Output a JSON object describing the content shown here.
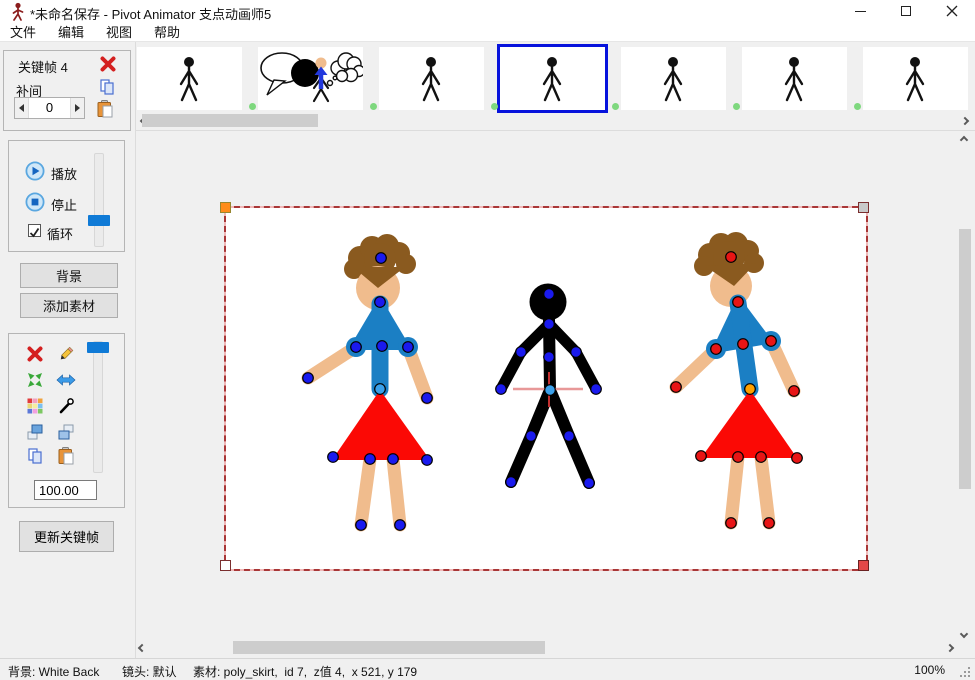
{
  "window": {
    "title": "*未命名保存 - Pivot Animator 支点动画师5"
  },
  "menu": {
    "items": [
      {
        "label": "文件"
      },
      {
        "label": "编辑"
      },
      {
        "label": "视图"
      },
      {
        "label": "帮助"
      }
    ]
  },
  "sidebar": {
    "keyframe_label": "关键帧 4",
    "tween_label": "补间",
    "tween_value": "0",
    "play_label": "播放",
    "stop_label": "停止",
    "loop_label": "循环",
    "loop_checked": true,
    "background_button": "背景",
    "add_sprite_button": "添加素材",
    "scale_value": "100.00",
    "update_keyframe_button": "更新关键帧",
    "icons": [
      "delete-x",
      "copy",
      "paste",
      "edit-pencil",
      "center-arrows",
      "flip-horizontal",
      "color-palette",
      "segment-tool",
      "raise-layer",
      "lower-layer"
    ]
  },
  "filmstrip": {
    "selected_frame": 4,
    "frames": [
      {
        "index": 1,
        "content": "stick-figure"
      },
      {
        "index": 2,
        "content": "speech-bubble-scene"
      },
      {
        "index": 3,
        "content": "stick-figure"
      },
      {
        "index": 4,
        "content": "stick-figure"
      },
      {
        "index": 5,
        "content": "stick-figure"
      },
      {
        "index": 6,
        "content": "stick-figure"
      },
      {
        "index": 7,
        "content": "stick-figure"
      }
    ]
  },
  "canvas": {
    "sprites": [
      "girl-sprite-left",
      "stick-figure-center",
      "girl-sprite-right-selected"
    ]
  },
  "statusbar": {
    "background": "背景: White Back",
    "camera": "镜头: 默认",
    "sprite": "素材: poly_skirt,  id 7,  z值 4,  x 521, y 179",
    "zoom": "100%"
  },
  "colors": {
    "accent_blue": "#0f7ad6",
    "selection_blue": "#0713dc",
    "dot_green": "#7ed87e",
    "skin": "#f0bc8d",
    "hair": "#8a5a1f",
    "top_blue": "#1b7fc4",
    "skirt_red": "#fb0905",
    "joint_blue": "#1a1aee",
    "joint_red": "#e81515",
    "origin_orange": "#ffa000",
    "origin_lightblue": "#3aa0ea"
  }
}
